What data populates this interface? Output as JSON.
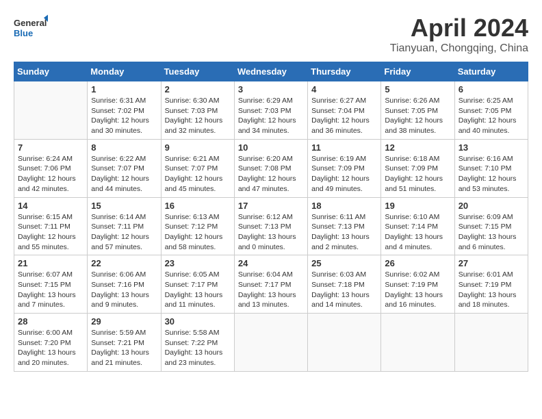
{
  "header": {
    "logo_line1": "General",
    "logo_line2": "Blue",
    "month_title": "April 2024",
    "subtitle": "Tianyuan, Chongqing, China"
  },
  "days_of_week": [
    "Sunday",
    "Monday",
    "Tuesday",
    "Wednesday",
    "Thursday",
    "Friday",
    "Saturday"
  ],
  "weeks": [
    [
      {
        "day": "",
        "info": ""
      },
      {
        "day": "1",
        "info": "Sunrise: 6:31 AM\nSunset: 7:02 PM\nDaylight: 12 hours\nand 30 minutes."
      },
      {
        "day": "2",
        "info": "Sunrise: 6:30 AM\nSunset: 7:03 PM\nDaylight: 12 hours\nand 32 minutes."
      },
      {
        "day": "3",
        "info": "Sunrise: 6:29 AM\nSunset: 7:03 PM\nDaylight: 12 hours\nand 34 minutes."
      },
      {
        "day": "4",
        "info": "Sunrise: 6:27 AM\nSunset: 7:04 PM\nDaylight: 12 hours\nand 36 minutes."
      },
      {
        "day": "5",
        "info": "Sunrise: 6:26 AM\nSunset: 7:05 PM\nDaylight: 12 hours\nand 38 minutes."
      },
      {
        "day": "6",
        "info": "Sunrise: 6:25 AM\nSunset: 7:05 PM\nDaylight: 12 hours\nand 40 minutes."
      }
    ],
    [
      {
        "day": "7",
        "info": "Sunrise: 6:24 AM\nSunset: 7:06 PM\nDaylight: 12 hours\nand 42 minutes."
      },
      {
        "day": "8",
        "info": "Sunrise: 6:22 AM\nSunset: 7:07 PM\nDaylight: 12 hours\nand 44 minutes."
      },
      {
        "day": "9",
        "info": "Sunrise: 6:21 AM\nSunset: 7:07 PM\nDaylight: 12 hours\nand 45 minutes."
      },
      {
        "day": "10",
        "info": "Sunrise: 6:20 AM\nSunset: 7:08 PM\nDaylight: 12 hours\nand 47 minutes."
      },
      {
        "day": "11",
        "info": "Sunrise: 6:19 AM\nSunset: 7:09 PM\nDaylight: 12 hours\nand 49 minutes."
      },
      {
        "day": "12",
        "info": "Sunrise: 6:18 AM\nSunset: 7:09 PM\nDaylight: 12 hours\nand 51 minutes."
      },
      {
        "day": "13",
        "info": "Sunrise: 6:16 AM\nSunset: 7:10 PM\nDaylight: 12 hours\nand 53 minutes."
      }
    ],
    [
      {
        "day": "14",
        "info": "Sunrise: 6:15 AM\nSunset: 7:11 PM\nDaylight: 12 hours\nand 55 minutes."
      },
      {
        "day": "15",
        "info": "Sunrise: 6:14 AM\nSunset: 7:11 PM\nDaylight: 12 hours\nand 57 minutes."
      },
      {
        "day": "16",
        "info": "Sunrise: 6:13 AM\nSunset: 7:12 PM\nDaylight: 12 hours\nand 58 minutes."
      },
      {
        "day": "17",
        "info": "Sunrise: 6:12 AM\nSunset: 7:13 PM\nDaylight: 13 hours\nand 0 minutes."
      },
      {
        "day": "18",
        "info": "Sunrise: 6:11 AM\nSunset: 7:13 PM\nDaylight: 13 hours\nand 2 minutes."
      },
      {
        "day": "19",
        "info": "Sunrise: 6:10 AM\nSunset: 7:14 PM\nDaylight: 13 hours\nand 4 minutes."
      },
      {
        "day": "20",
        "info": "Sunrise: 6:09 AM\nSunset: 7:15 PM\nDaylight: 13 hours\nand 6 minutes."
      }
    ],
    [
      {
        "day": "21",
        "info": "Sunrise: 6:07 AM\nSunset: 7:15 PM\nDaylight: 13 hours\nand 7 minutes."
      },
      {
        "day": "22",
        "info": "Sunrise: 6:06 AM\nSunset: 7:16 PM\nDaylight: 13 hours\nand 9 minutes."
      },
      {
        "day": "23",
        "info": "Sunrise: 6:05 AM\nSunset: 7:17 PM\nDaylight: 13 hours\nand 11 minutes."
      },
      {
        "day": "24",
        "info": "Sunrise: 6:04 AM\nSunset: 7:17 PM\nDaylight: 13 hours\nand 13 minutes."
      },
      {
        "day": "25",
        "info": "Sunrise: 6:03 AM\nSunset: 7:18 PM\nDaylight: 13 hours\nand 14 minutes."
      },
      {
        "day": "26",
        "info": "Sunrise: 6:02 AM\nSunset: 7:19 PM\nDaylight: 13 hours\nand 16 minutes."
      },
      {
        "day": "27",
        "info": "Sunrise: 6:01 AM\nSunset: 7:19 PM\nDaylight: 13 hours\nand 18 minutes."
      }
    ],
    [
      {
        "day": "28",
        "info": "Sunrise: 6:00 AM\nSunset: 7:20 PM\nDaylight: 13 hours\nand 20 minutes."
      },
      {
        "day": "29",
        "info": "Sunrise: 5:59 AM\nSunset: 7:21 PM\nDaylight: 13 hours\nand 21 minutes."
      },
      {
        "day": "30",
        "info": "Sunrise: 5:58 AM\nSunset: 7:22 PM\nDaylight: 13 hours\nand 23 minutes."
      },
      {
        "day": "",
        "info": ""
      },
      {
        "day": "",
        "info": ""
      },
      {
        "day": "",
        "info": ""
      },
      {
        "day": "",
        "info": ""
      }
    ]
  ]
}
